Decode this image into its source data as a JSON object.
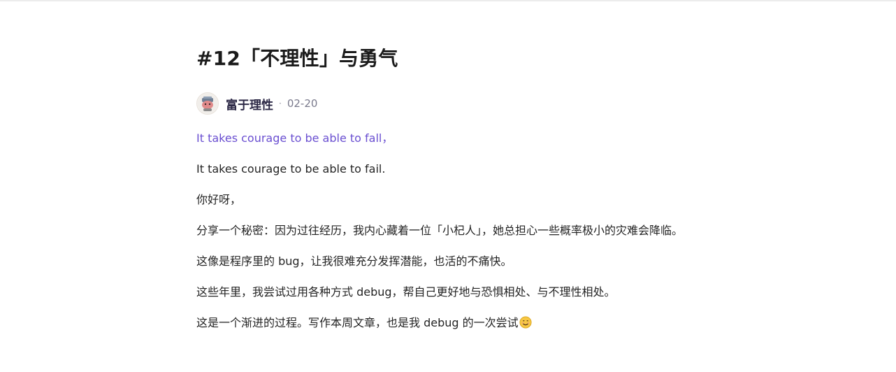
{
  "article": {
    "title": "#12「不理性」与勇气",
    "author": {
      "name": "富于理性",
      "avatar_icon": "avatar-illustration"
    },
    "separator": "·",
    "date": "02-20",
    "paragraphs": [
      {
        "text": "It takes courage to be able to fall，",
        "style": "quote",
        "color": "#6a4fd1"
      },
      {
        "text": "It takes courage to be able to fail.",
        "style": "normal"
      },
      {
        "text": "你好呀，",
        "style": "normal"
      },
      {
        "text": "分享一个秘密：因为过往经历，我内心藏着一位「小杞人」，她总担心一些概率极小的灾难会降临。",
        "style": "normal"
      },
      {
        "text": "这像是程序里的 bug，让我很难充分发挥潜能，也活的不痛快。",
        "style": "normal"
      },
      {
        "text": "这些年里，我尝试过用各种方式 debug，帮自己更好地与恐惧相处、与不理性相处。",
        "style": "normal"
      },
      {
        "text": "这是一个渐进的过程。写作本周文章，也是我 debug 的一次尝试",
        "style": "normal",
        "emoji": "smiling-face-icon"
      }
    ]
  }
}
